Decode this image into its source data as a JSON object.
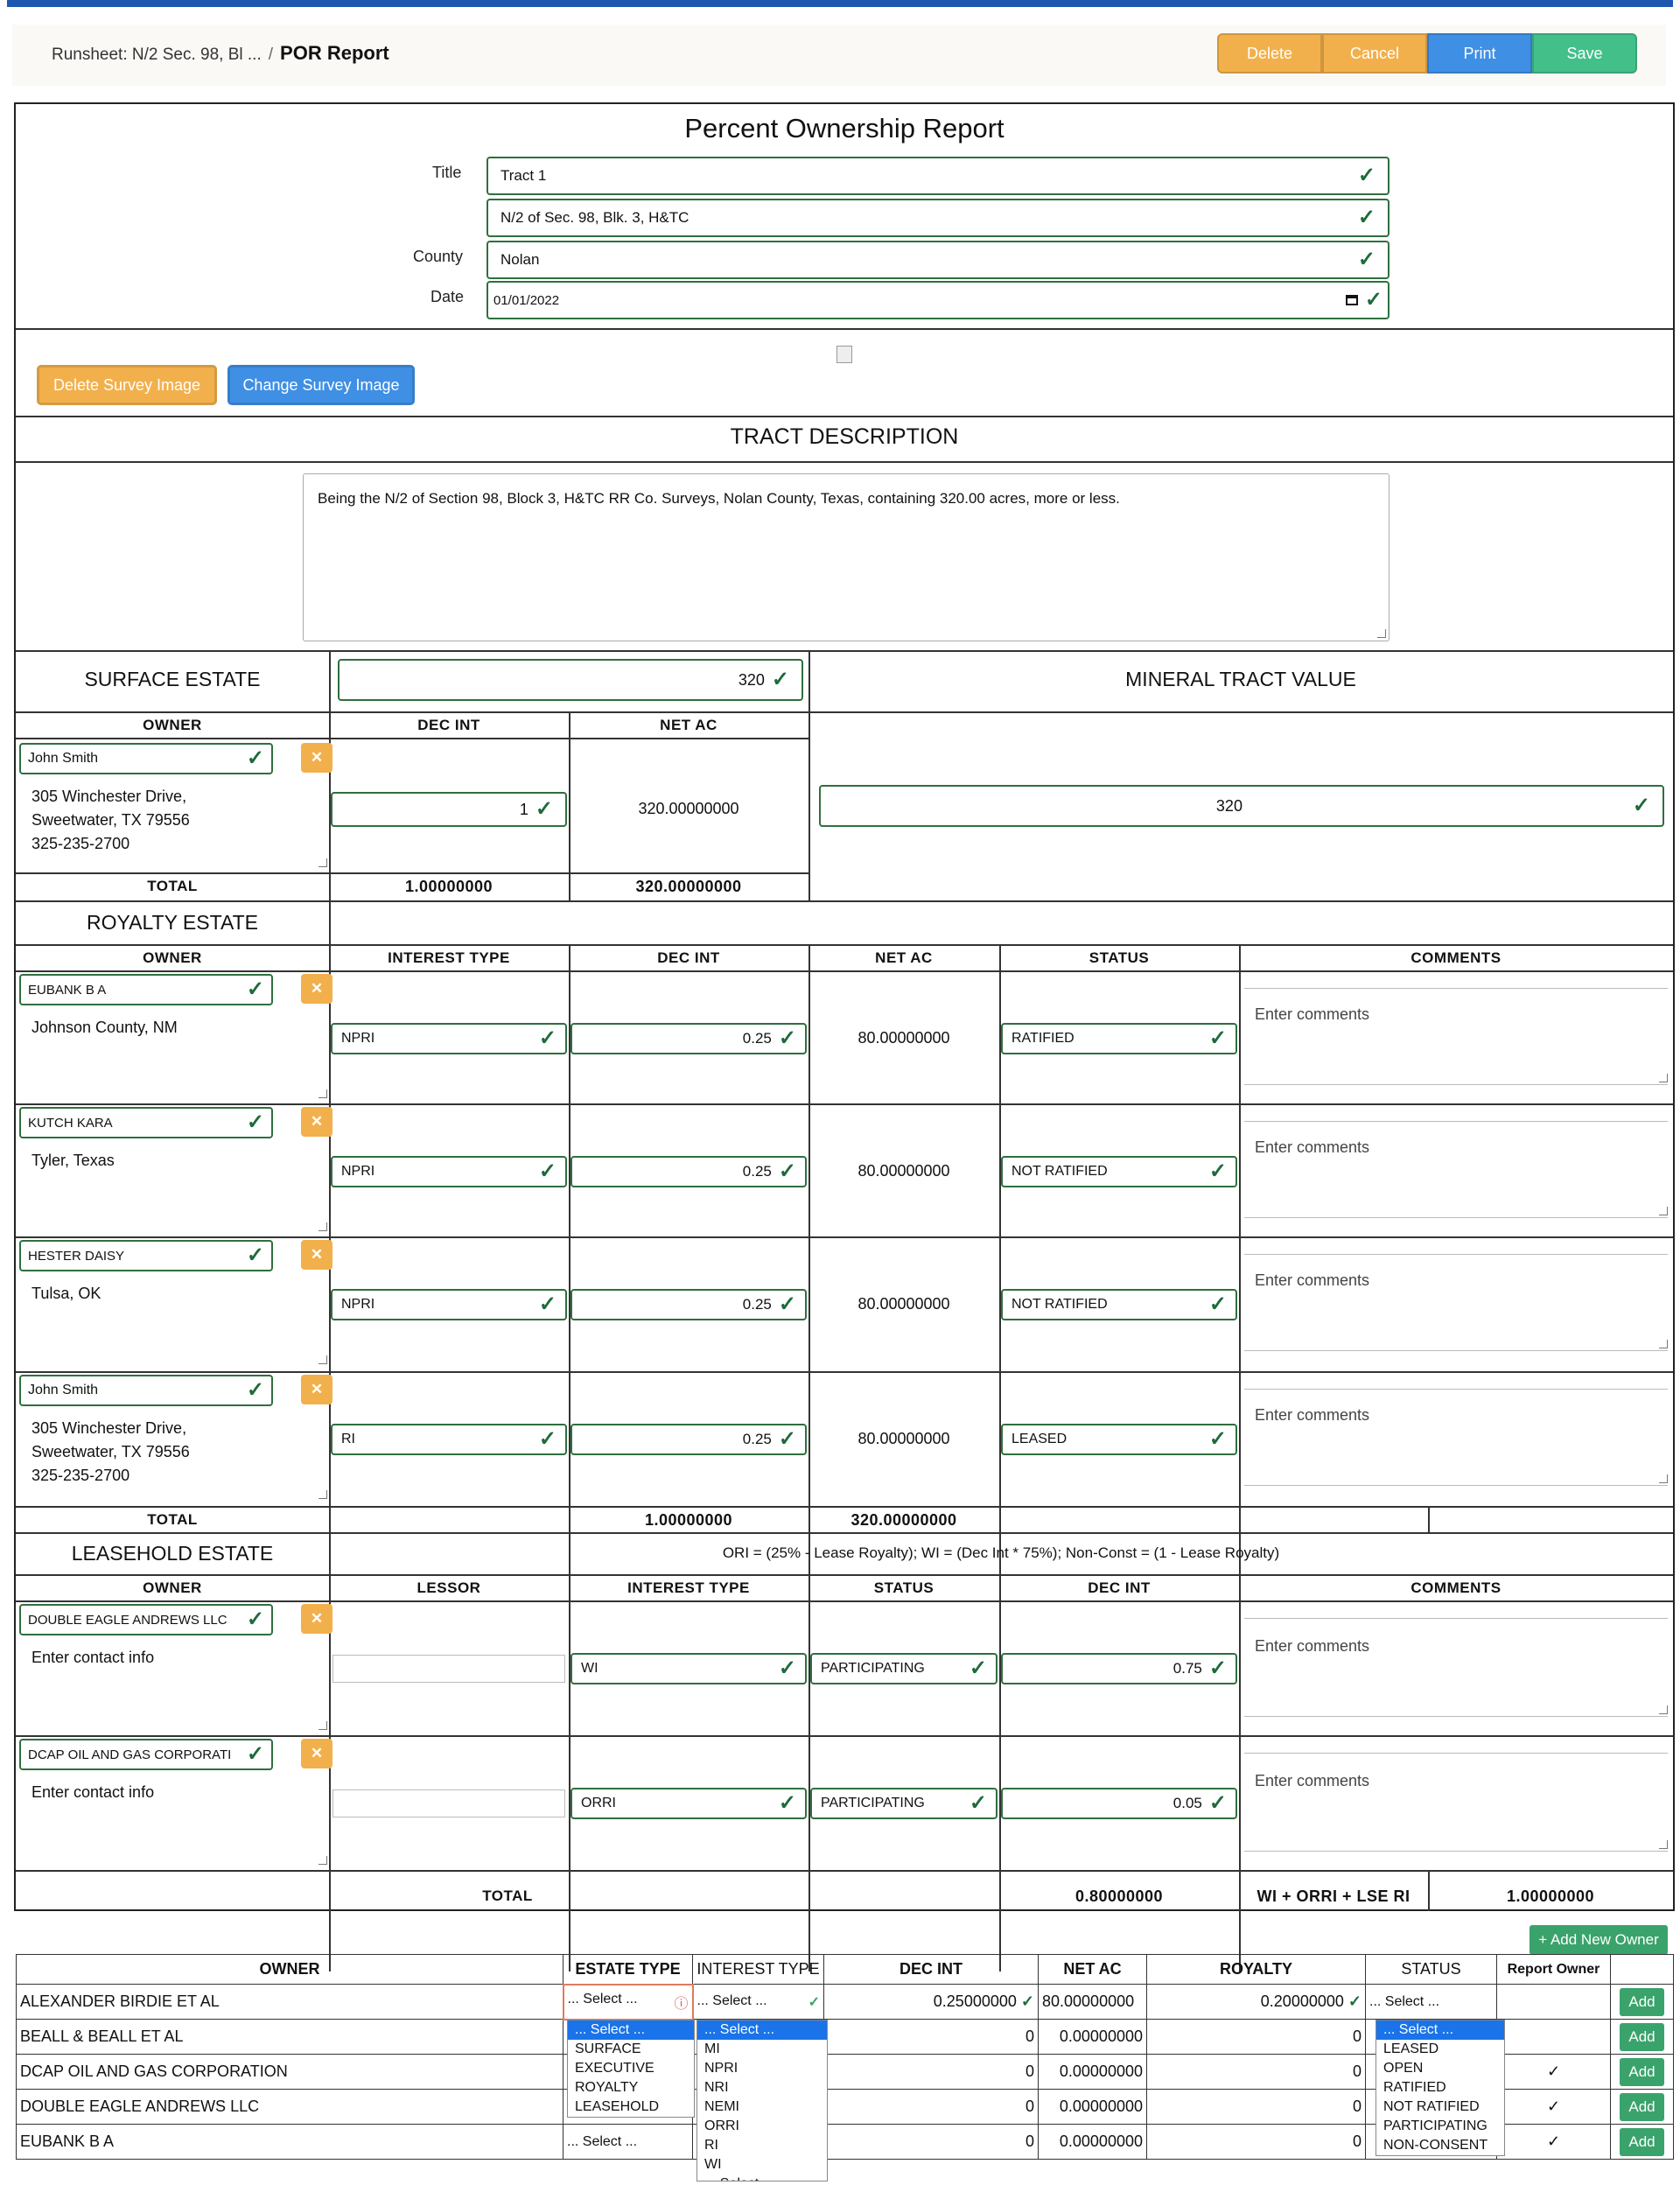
{
  "header": {
    "breadcrumb": "Runsheet: N/2 Sec. 98, Bl ...",
    "separator": "/",
    "page_title": "POR Report",
    "buttons": {
      "delete": "Delete",
      "cancel": "Cancel",
      "print": "Print",
      "save": "Save"
    }
  },
  "report": {
    "heading": "Percent Ownership Report",
    "title_label": "Title",
    "title_value": "Tract 1",
    "subtitle_value": "N/2 of Sec. 98, Blk. 3, H&TC",
    "county_label": "County",
    "county_value": "Nolan",
    "date_label": "Date",
    "date_value": "01/01/2022",
    "delete_image": "Delete Survey Image",
    "change_image": "Change Survey Image",
    "tract_heading": "TRACT DESCRIPTION",
    "tract_text": "Being the N/2 of Section 98, Block 3, H&TC RR Co. Surveys, Nolan County, Texas, containing 320.00 acres, more or less."
  },
  "surface": {
    "heading": "SURFACE ESTATE",
    "acres": "320",
    "mineral_heading": "MINERAL TRACT VALUE",
    "mineral_value": "320",
    "col_owner": "OWNER",
    "col_dec": "DEC INT",
    "col_net": "NET AC",
    "owner": "John Smith",
    "address": [
      "305 Winchester Drive,",
      "Sweetwater, TX 79556",
      " 325-235-2700"
    ],
    "dec": "1",
    "net": "320.00000000",
    "total_label": "TOTAL",
    "total_dec": "1.00000000",
    "total_net": "320.00000000"
  },
  "royalty": {
    "heading": "ROYALTY ESTATE",
    "cols": [
      "OWNER",
      "INTEREST TYPE",
      "DEC INT",
      "NET AC",
      "STATUS",
      "COMMENTS"
    ],
    "comment_placeholder": "Enter comments",
    "rows": [
      {
        "owner": "EUBANK B A",
        "address": [
          "Johnson County, NM"
        ],
        "type": "NPRI",
        "dec": "0.25",
        "net": "80.00000000",
        "status": "RATIFIED"
      },
      {
        "owner": "KUTCH KARA",
        "address": [
          "Tyler, Texas"
        ],
        "type": "NPRI",
        "dec": "0.25",
        "net": "80.00000000",
        "status": "NOT RATIFIED"
      },
      {
        "owner": "HESTER DAISY",
        "address": [
          "Tulsa, OK"
        ],
        "type": "NPRI",
        "dec": "0.25",
        "net": "80.00000000",
        "status": "NOT RATIFIED"
      },
      {
        "owner": "John Smith",
        "address": [
          "305 Winchester Drive,",
          "Sweetwater, TX 79556",
          " 325-235-2700"
        ],
        "type": "RI",
        "dec": "0.25",
        "net": "80.00000000",
        "status": "LEASED"
      }
    ],
    "total_label": "TOTAL",
    "total_dec": "1.00000000",
    "total_net": "320.00000000"
  },
  "leasehold": {
    "heading": "LEASEHOLD ESTATE",
    "formula": "ORI = (25% - Lease Royalty); WI = (Dec Int * 75%); Non-Const = (1 - Lease Royalty)",
    "cols": [
      "OWNER",
      "LESSOR",
      "INTEREST TYPE",
      "STATUS",
      "DEC INT",
      "COMMENTS"
    ],
    "contact_placeholder": "Enter contact info",
    "comment_placeholder": "Enter comments",
    "rows": [
      {
        "owner": "DOUBLE EAGLE ANDREWS LLC",
        "type": "WI",
        "status": "PARTICIPATING",
        "dec": "0.75"
      },
      {
        "owner": "DCAP OIL AND GAS CORPORATI",
        "type": "ORRI",
        "status": "PARTICIPATING",
        "dec": "0.05"
      }
    ],
    "total_label": "TOTAL",
    "total_dec": "0.80000000",
    "sum_label": "WI + ORRI + LSE RI",
    "sum_value": "1.00000000"
  },
  "owners_table": {
    "new_owner": "+ Add New Owner",
    "cols": [
      "OWNER",
      "ESTATE TYPE",
      "INTEREST TYPE",
      "DEC INT",
      "NET AC",
      "ROYALTY",
      "STATUS",
      "Report Owner",
      ""
    ],
    "rows": [
      {
        "owner": "ALEXANDER BIRDIE ET AL",
        "estate": "... Select ...",
        "interest": "... Select ...",
        "dec": "0.25000000",
        "net": "80.00000000",
        "royalty": "0.20000000",
        "status": "... Select ...",
        "report": "",
        "add": "Add"
      },
      {
        "owner": "BEALL & BEALL ET AL",
        "estate": "",
        "interest": "",
        "dec": "0",
        "net": "0.00000000",
        "royalty": "0",
        "status": "",
        "report": "",
        "add": "Add"
      },
      {
        "owner": "DCAP OIL AND GAS CORPORATION",
        "estate": "",
        "interest": "",
        "dec": "0",
        "net": "0.00000000",
        "royalty": "0",
        "status": "",
        "report": "✓",
        "add": "Add"
      },
      {
        "owner": "DOUBLE EAGLE ANDREWS LLC",
        "estate": "",
        "interest": "",
        "dec": "0",
        "net": "0.00000000",
        "royalty": "0",
        "status": "",
        "report": "✓",
        "add": "Add"
      },
      {
        "owner": "EUBANK B A",
        "estate": "... Select ...",
        "interest": "",
        "dec": "0",
        "net": "0.00000000",
        "royalty": "0",
        "status": "",
        "report": "✓",
        "add": "Add"
      }
    ],
    "estate_options": [
      "... Select ...",
      "SURFACE",
      "EXECUTIVE",
      "ROYALTY",
      "LEASEHOLD"
    ],
    "interest_options": [
      "... Select ...",
      "MI",
      "NPRI",
      "NRI",
      "NEMI",
      "ORRI",
      "RI",
      "WI",
      "... Select ..."
    ],
    "status_options": [
      "... Select ...",
      "LEASED",
      "OPEN",
      "RATIFIED",
      "NOT RATIFIED",
      "PARTICIPATING",
      "NON-CONSENT"
    ]
  }
}
